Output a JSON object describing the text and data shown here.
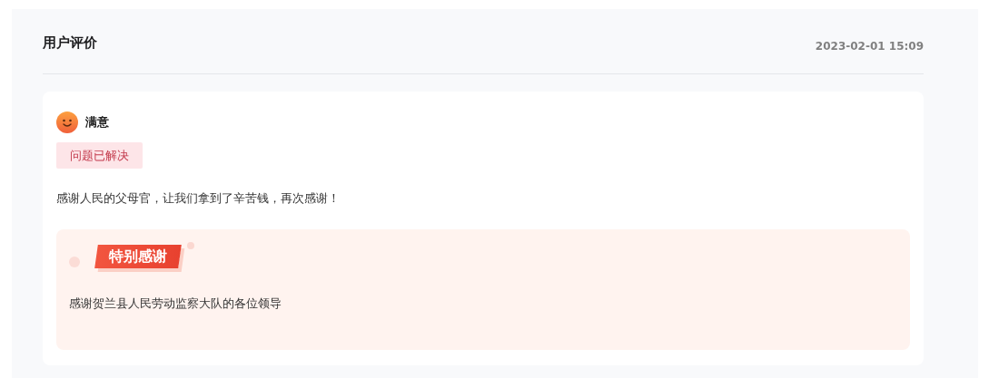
{
  "header": {
    "title": "用户评价",
    "date": "2023-02-01 15:09"
  },
  "review": {
    "rating": {
      "kind": "satisfied",
      "label": "满意"
    },
    "tags": [
      "问题已解决"
    ],
    "comment": "感谢人民的父母官，让我们拿到了辛苦钱，再次感谢！",
    "thanks": {
      "badge": "特别感谢",
      "text": "感谢贺兰县人民劳动监察大队的各位领导"
    }
  }
}
